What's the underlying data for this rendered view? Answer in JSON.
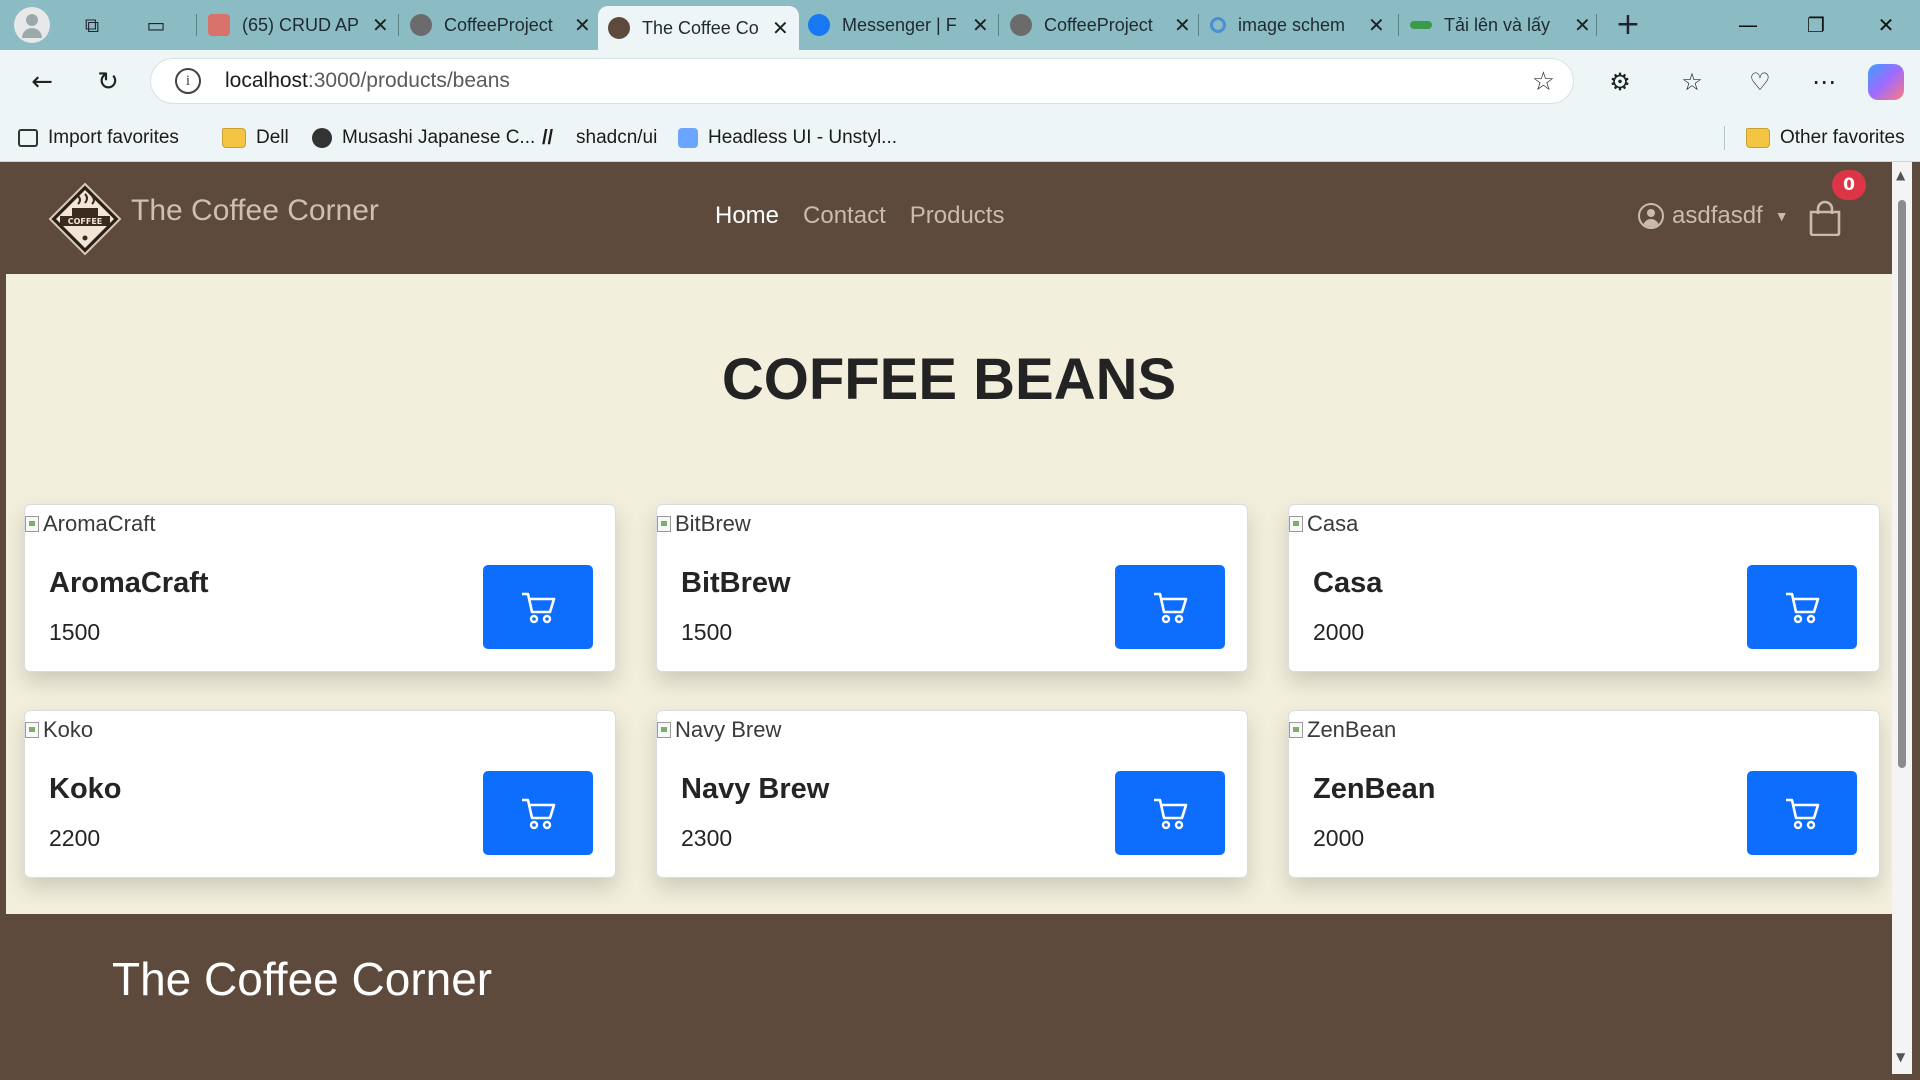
{
  "browser": {
    "tabs": [
      {
        "title": "(65) CRUD AP",
        "favicon": "youtube-icon",
        "color": "#d8726a"
      },
      {
        "title": "CoffeeProject",
        "favicon": "github-icon",
        "color": "#2b2b2b"
      },
      {
        "title": "The Coffee Co",
        "favicon": "coffee-logo-icon",
        "color": "#5e4a3c"
      },
      {
        "title": "Messenger | F",
        "favicon": "facebook-icon",
        "color": "#1877f2"
      },
      {
        "title": "CoffeeProject",
        "favicon": "github-icon",
        "color": "#2b2b2b"
      },
      {
        "title": "image schem",
        "favicon": "search-icon",
        "color": "#4a8fd6"
      },
      {
        "title": "Tải lên và lấy",
        "favicon": "link-icon",
        "color": "#3a9a4a"
      }
    ],
    "active_tab": 2,
    "address": {
      "host": "localhost",
      "path": ":3000/products/beans"
    },
    "favorites": [
      {
        "label": "Import favorites",
        "icon": "import-icon"
      },
      {
        "label": "Dell",
        "icon": "folder-icon"
      },
      {
        "label": "Musashi Japanese C...",
        "icon": "musashi-icon"
      },
      {
        "label": "shadcn/ui",
        "icon": "shadcn-icon"
      },
      {
        "label": "Headless UI - Unstyl...",
        "icon": "headlessui-icon"
      }
    ],
    "other_favorites": "Other favorites"
  },
  "site": {
    "brand": "The Coffee Corner",
    "logo_text": "COFFEE",
    "nav": [
      {
        "label": "Home",
        "active": true
      },
      {
        "label": "Contact",
        "active": false
      },
      {
        "label": "Products",
        "active": false
      }
    ],
    "user": "asdfasdf",
    "cart_count": "0",
    "accent": "#0d6efd",
    "header_bg": "#5e4a3c",
    "page_bg": "#f2f0dc"
  },
  "main": {
    "title": "COFFEE BEANS",
    "products": [
      {
        "name": "AromaCraft",
        "price": "1500",
        "alt": "AromaCraft"
      },
      {
        "name": "BitBrew",
        "price": "1500",
        "alt": "BitBrew"
      },
      {
        "name": "Casa",
        "price": "2000",
        "alt": "Casa"
      },
      {
        "name": "Koko",
        "price": "2200",
        "alt": "Koko"
      },
      {
        "name": "Navy Brew",
        "price": "2300",
        "alt": "Navy Brew"
      },
      {
        "name": "ZenBean",
        "price": "2000",
        "alt": "ZenBean"
      }
    ]
  },
  "footer": {
    "title": "The Coffee Corner"
  }
}
